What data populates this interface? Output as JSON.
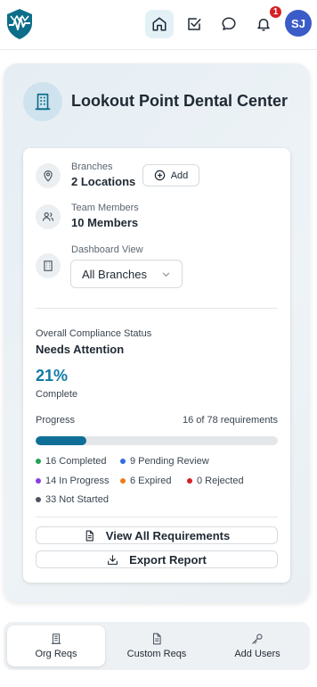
{
  "header": {
    "notification_count": "1",
    "avatar_initials": "SJ",
    "brand_color": "#0d6e8a"
  },
  "org": {
    "name": "Lookout Point Dental Center",
    "branches_label": "Branches",
    "branches_value": "2 Locations",
    "add_label": "Add",
    "members_label": "Team Members",
    "members_value": "10 Members",
    "dashboard_label": "Dashboard View",
    "dashboard_value": "All Branches"
  },
  "compliance": {
    "status_label": "Overall Compliance Status",
    "status_value": "Needs Attention",
    "percent": "21%",
    "complete_label": "Complete",
    "progress_label": "Progress",
    "progress_count": "16 of 78 requirements",
    "progress_fraction": 0.21,
    "legend": [
      {
        "label": "16 Completed",
        "color": "#22a355"
      },
      {
        "label": "9 Pending Review",
        "color": "#2f6fe0"
      },
      {
        "label": "14 In Progress",
        "color": "#8b3fe0"
      },
      {
        "label": "6 Expired",
        "color": "#f07a1a"
      },
      {
        "label": "0 Rejected",
        "color": "#d81f26"
      },
      {
        "label": "33 Not Started",
        "color": "#4b5560"
      }
    ],
    "view_all_label": "View All Requirements",
    "export_label": "Export Report"
  },
  "tabs": [
    {
      "label": "Org Reqs"
    },
    {
      "label": "Custom Reqs"
    },
    {
      "label": "Add Users"
    }
  ]
}
